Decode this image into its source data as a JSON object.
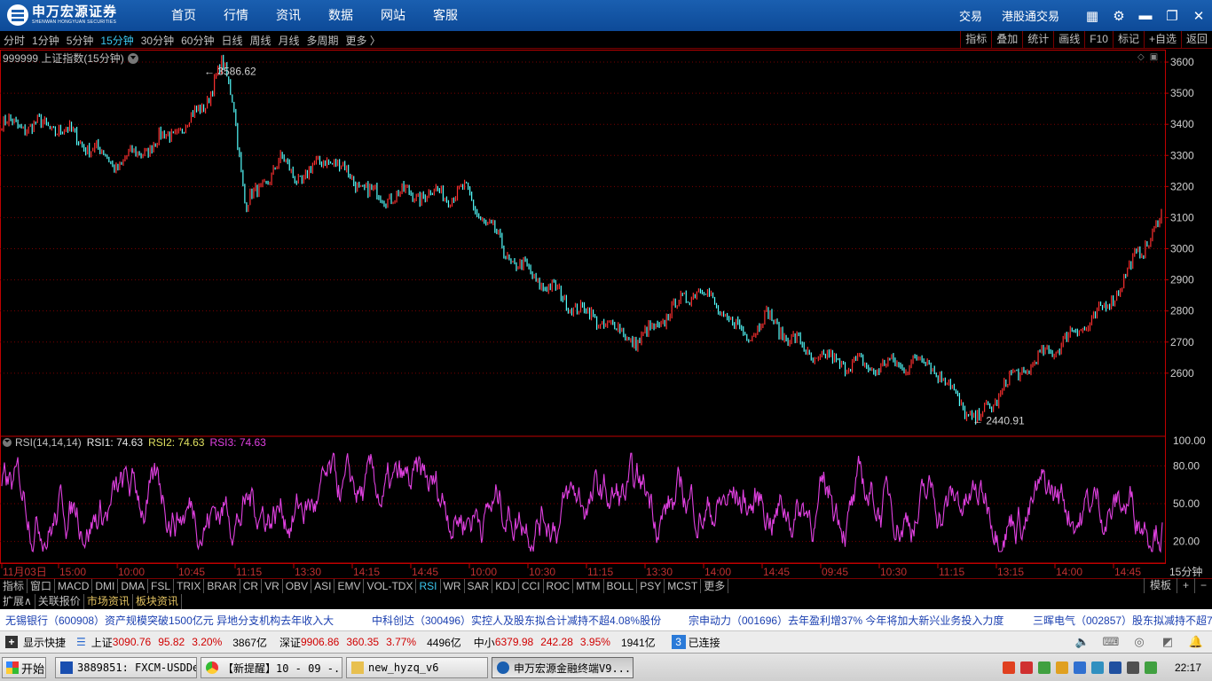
{
  "app": {
    "logo_cn": "申万宏源证券",
    "logo_en": "SHENWAN HONGYUAN SECURITIES",
    "nav": [
      "首页",
      "行情",
      "资讯",
      "数据",
      "网站",
      "客服"
    ],
    "right_links": [
      "交易",
      "港股通交易"
    ],
    "icons": [
      "grid-icon",
      "gear-icon",
      "minimize-icon",
      "restore-icon",
      "close-icon"
    ]
  },
  "periods": {
    "items": [
      "分时",
      "1分钟",
      "5分钟",
      "15分钟",
      "30分钟",
      "60分钟",
      "日线",
      "周线",
      "月线",
      "多周期",
      "更多 〉"
    ],
    "active": "15分钟",
    "right": [
      "指标",
      "叠加",
      "统计",
      "画线",
      "F10",
      "标记",
      "+自选",
      "返回"
    ]
  },
  "main_chart": {
    "label": "999999 上证指数(15分钟)",
    "high_label": "3586.62",
    "low_label": "2440.91",
    "y_ticks": [
      "3600",
      "3500",
      "3400",
      "3300",
      "3200",
      "3100",
      "3000",
      "2900",
      "2800",
      "2700",
      "2600"
    ]
  },
  "rsi": {
    "name": "RSI(14,14,14)",
    "rsi1": "RSI1: 74.63",
    "rsi2": "RSI2: 74.63",
    "rsi3": "RSI3: 74.63",
    "y_ticks": [
      "100.00",
      "80.00",
      "50.00",
      "20.00"
    ]
  },
  "x_axis": {
    "labels": [
      "11月03日",
      "15:00",
      "10:00",
      "10:45",
      "11:15",
      "13:30",
      "14:15",
      "14:45",
      "10:00",
      "10:30",
      "11:15",
      "13:30",
      "14:00",
      "14:45",
      "09:45",
      "10:30",
      "11:15",
      "13:15",
      "14:00",
      "14:45"
    ],
    "period_label": "15分钟"
  },
  "chart_data": {
    "type": "line",
    "title": "999999 上证指数(15分钟)",
    "series": [
      {
        "name": "上证指数",
        "x": [
          0,
          0.05,
          0.1,
          0.16,
          0.175,
          0.19,
          0.2,
          0.21,
          0.24,
          0.26,
          0.28,
          0.32,
          0.4,
          0.44,
          0.5,
          0.55,
          0.6,
          0.64,
          0.66,
          0.7,
          0.75,
          0.8,
          0.84,
          0.87,
          0.9,
          0.95,
          1.0
        ],
        "values": [
          3400,
          3390,
          3270,
          3400,
          3470,
          3586.62,
          3480,
          3130,
          3280,
          3220,
          3300,
          3170,
          3180,
          2960,
          2800,
          2700,
          2880,
          2720,
          2780,
          2650,
          2620,
          2640,
          2440.91,
          2580,
          2660,
          2800,
          3100
        ]
      }
    ],
    "ylim": [
      2400,
      3640
    ],
    "panels": [
      {
        "name": "RSI(14,14,14)",
        "series": [
          {
            "name": "RSI1",
            "last": 74.63
          },
          {
            "name": "RSI2",
            "last": 74.63
          },
          {
            "name": "RSI3",
            "last": 74.63
          }
        ],
        "ylim": [
          0,
          100
        ]
      }
    ]
  },
  "indicator_tabs": {
    "items": [
      "指标",
      "窗口",
      "MACD",
      "DMI",
      "DMA",
      "FSL",
      "TRIX",
      "BRAR",
      "CR",
      "VR",
      "OBV",
      "ASI",
      "EMV",
      "VOL-TDX",
      "RSI",
      "WR",
      "SAR",
      "KDJ",
      "CCI",
      "ROC",
      "MTM",
      "BOLL",
      "PSY",
      "MCST",
      "更多"
    ],
    "active": "RSI",
    "right": [
      "模板",
      "+",
      "−"
    ]
  },
  "ext_tabs": [
    "扩展∧",
    "关联报价",
    "市场资讯",
    "板块资讯"
  ],
  "news": [
    "无锡银行（600908）资产规模突破1500亿元  异地分支机构去年收入大",
    "中科创达（300496）实控人及股东拟合计减持不超4.08%股份",
    "宗申动力（001696）去年盈利增37%  今年将加大新兴业务投入力度",
    "三晖电气（002857）股东拟减持不超7"
  ],
  "status": {
    "show_shortcut": "显示快捷",
    "sh": {
      "name": "上证",
      "price": "3090.76",
      "change": "95.82",
      "pct": "3.20%",
      "amount": "3867亿"
    },
    "sz": {
      "name": "深证",
      "price": "9906.86",
      "change": "360.35",
      "pct": "3.77%",
      "amount": "4496亿"
    },
    "zx": {
      "name": "中小",
      "price": "6379.98",
      "change": "242.28",
      "pct": "3.95%",
      "amount": "1941亿"
    },
    "conn_count": "3",
    "conn_text": "已连接"
  },
  "taskbar": {
    "start": "开始",
    "tasks": [
      "3889851: FXCM-USDDe...",
      "【新提醒】10 - 09 -...",
      "new_hyzq_v6",
      "申万宏源金融终端V9...."
    ],
    "clock": "22:17"
  },
  "colors": {
    "up": "#ff3030",
    "down": "#54ffff",
    "rsi": "#e040e0",
    "grid": "#7a0000",
    "axis": "#c00000",
    "brand": "#1a5fb0"
  }
}
